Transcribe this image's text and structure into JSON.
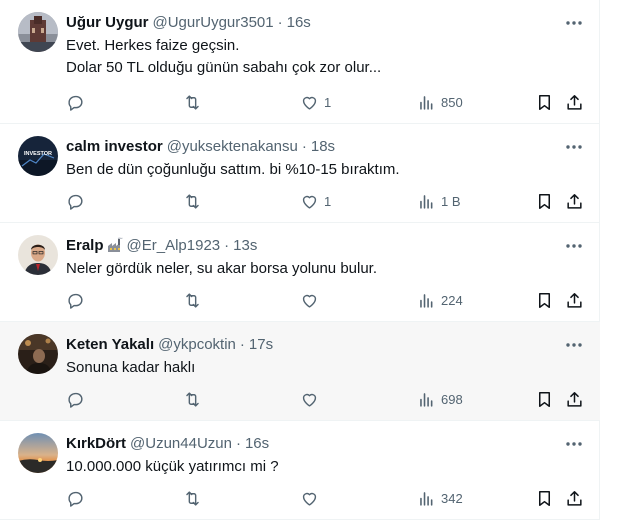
{
  "tweets": [
    {
      "name": "Uğur Uygur",
      "handle": "@UgurUygur3501",
      "separator": "·",
      "time": "16s",
      "text": "Evet. Herkes faize geçsin.\nDolar 50 TL olduğu günün sabahı çok zor olur...",
      "likes": "1",
      "views": "850",
      "avatar": "building-photo"
    },
    {
      "name": "calm investor",
      "handle": "@yuksektenakansu",
      "separator": "·",
      "time": "18s",
      "text": "Ben de dün çoğunluğu sattım. bi %10-15 bıraktım.",
      "avatar_text": "INVESTOR",
      "likes": "1",
      "views": "1 B",
      "avatar": "investor-badge"
    },
    {
      "name": "Eralp",
      "name_emoji": "factory-emoji",
      "handle": "@Er_Alp1923",
      "separator": "·",
      "time": "13s",
      "text": "Neler gördük neler, su akar borsa yolunu bulur.",
      "likes": "",
      "views": "224",
      "avatar": "portrait-photo"
    },
    {
      "name": "Keten Yakalı",
      "handle": "@ykpcoktin",
      "separator": "·",
      "time": "17s",
      "text": "Sonuna kadar haklı",
      "likes": "",
      "views": "698",
      "avatar": "dark-photo",
      "hovered": true
    },
    {
      "name": "KırkDört",
      "handle": "@Uzun44Uzun",
      "separator": "·",
      "time": "16s",
      "text": "10.000.000 küçük yatırımcı mi ?",
      "likes": "",
      "views": "342",
      "avatar": "sunset-photo"
    }
  ],
  "colors": {
    "text": "#0f1419",
    "secondary": "#536471",
    "border": "#eff3f4",
    "hover_bg": "#f7f7f7"
  }
}
